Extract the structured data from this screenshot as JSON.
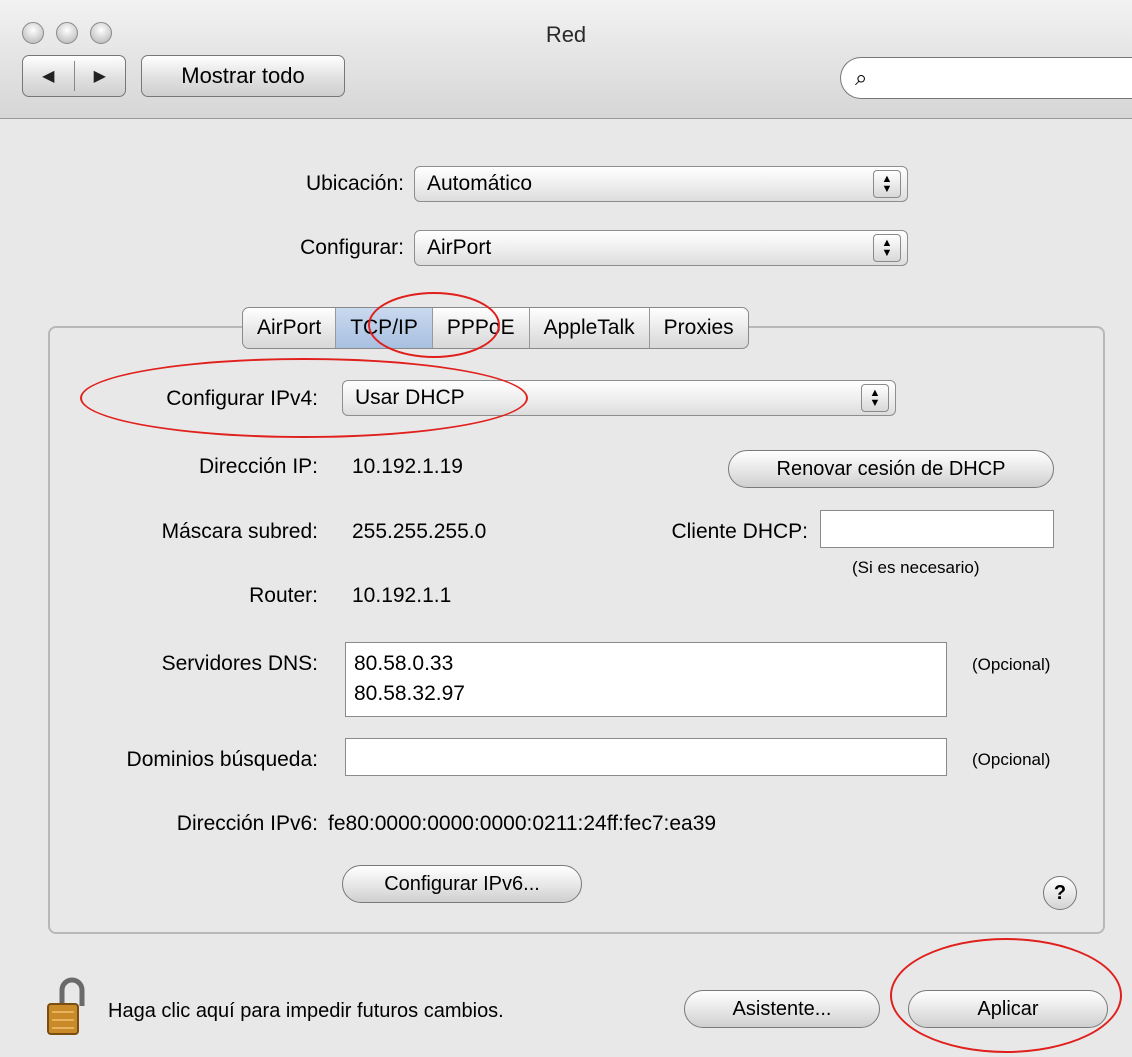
{
  "window": {
    "title": "Red"
  },
  "toolbar": {
    "back_label": "◀",
    "forward_label": "▶",
    "show_all_label": "Mostrar todo",
    "search_icon_glyph": "🔍",
    "search_placeholder": ""
  },
  "location": {
    "label": "Ubicación:",
    "value": "Automático"
  },
  "configure": {
    "label": "Configurar:",
    "value": "AirPort"
  },
  "tabs": [
    {
      "label": "AirPort",
      "selected": false
    },
    {
      "label": "TCP/IP",
      "selected": true
    },
    {
      "label": "PPPoE",
      "selected": false
    },
    {
      "label": "AppleTalk",
      "selected": false
    },
    {
      "label": "Proxies",
      "selected": false
    }
  ],
  "tcpip": {
    "configure_ipv4_label": "Configurar IPv4:",
    "configure_ipv4_value": "Usar DHCP",
    "ip_label": "Dirección IP:",
    "ip_value": "10.192.1.19",
    "renew_dhcp_label": "Renovar cesión de DHCP",
    "subnet_label": "Máscara subred:",
    "subnet_value": "255.255.255.0",
    "dhcp_client_label": "Cliente DHCP:",
    "dhcp_client_value": "",
    "dhcp_client_hint": "(Si es necesario)",
    "router_label": "Router:",
    "router_value": "10.192.1.1",
    "dns_label": "Servidores DNS:",
    "dns_values": [
      "80.58.0.33",
      "80.58.32.97"
    ],
    "dns_hint": "(Opcional)",
    "search_domains_label": "Dominios búsqueda:",
    "search_domains_value": "",
    "search_domains_hint": "(Opcional)",
    "ipv6_label": "Dirección IPv6:",
    "ipv6_value": "fe80:0000:0000:0000:0211:24ff:fec7:ea39",
    "configure_ipv6_label": "Configurar IPv6...",
    "help_label": "?"
  },
  "footer": {
    "lock_text": "Haga clic aquí para impedir futuros cambios.",
    "assistant_label": "Asistente...",
    "apply_label": "Aplicar"
  },
  "colors": {
    "annotation_red": "#e0201c",
    "selected_tab": "#b7cbe7"
  }
}
